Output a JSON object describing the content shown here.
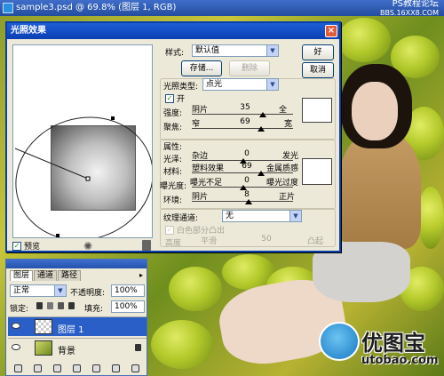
{
  "window": {
    "title": "sample3.psd @ 69.8% (图层 1, RGB)",
    "watermark": "PS教程论坛",
    "watermark_url": "BBS.16XX8.COM"
  },
  "dialog": {
    "title": "光照效果",
    "close_glyph": "×",
    "style_label": "样式:",
    "style_value": "默认值",
    "save_button": "存储...",
    "delete_button": "删除",
    "ok_button": "好",
    "cancel_button": "取消",
    "light_type_label": "光照类型:",
    "light_type_value": "点光",
    "on_label": "开",
    "on_checked": true,
    "intensity": {
      "label": "强度:",
      "left": "阴片",
      "value": "35",
      "right": "全"
    },
    "focus": {
      "label": "聚焦:",
      "left": "窄",
      "value": "69",
      "right": "宽"
    },
    "properties_label": "属性:",
    "gloss": {
      "label": "光泽:",
      "left": "杂边",
      "value": "0",
      "right": "发光"
    },
    "material": {
      "label": "材料:",
      "left": "塑料效果",
      "value": "69",
      "right": "金属质感"
    },
    "exposure": {
      "label": "曝光度:",
      "left": "曝光不足",
      "value": "0",
      "right": "曝光过度"
    },
    "ambience": {
      "label": "环境:",
      "left": "阴片",
      "value": "8",
      "right": "正片"
    },
    "texture_label": "纹理通道:",
    "texture_value": "无",
    "white_high_label": "白色部分凸出",
    "height": {
      "label": "高度",
      "left": "平滑",
      "value": "50",
      "right": "凸起"
    },
    "preview_label": "预览",
    "preview_checked": true,
    "bulb_icon": "light-bulb-icon",
    "trash_icon": "trash-icon",
    "checkmark_glyph": "✓",
    "dropdown_arrow_glyph": "▼",
    "bulb_glyph": "✺"
  },
  "layers": {
    "tabs": [
      "图层",
      "通道",
      "路径"
    ],
    "menu_glyph": "▸",
    "blend_mode": "正常",
    "opacity_label": "不透明度:",
    "opacity_value": "100%",
    "lock_label": "锁定:",
    "fill_label": "填充:",
    "fill_value": "100%",
    "rows": [
      {
        "name": "图层 1",
        "selected": true
      },
      {
        "name": "背景",
        "selected": false
      }
    ]
  },
  "brand": {
    "name": "优图宝",
    "url": "utobao.com"
  }
}
